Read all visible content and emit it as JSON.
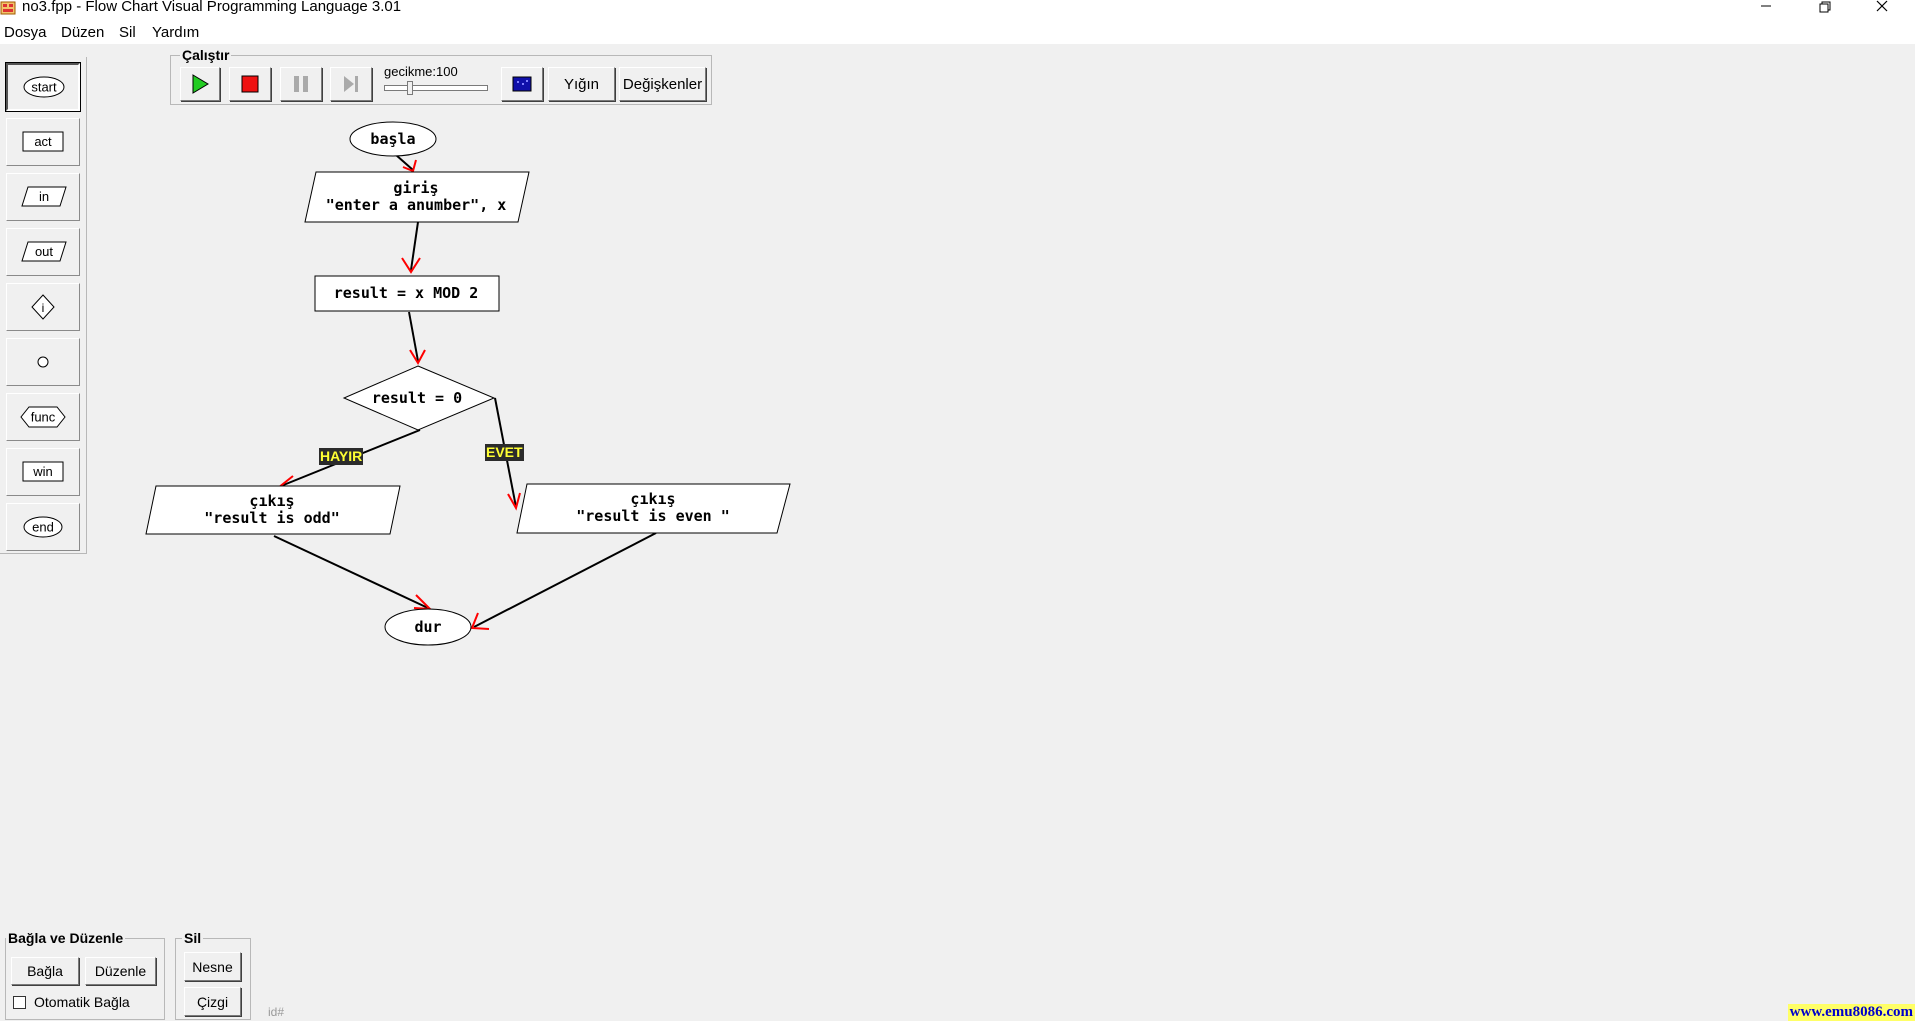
{
  "window": {
    "title": "no3.fpp - Flow Chart Visual Programming Language 3.01"
  },
  "menu": [
    "Dosya",
    "Düzen",
    "Sil",
    "Yardım"
  ],
  "palette": [
    {
      "name": "start",
      "label": "start",
      "active": true
    },
    {
      "name": "act",
      "label": "act"
    },
    {
      "name": "in",
      "label": "in"
    },
    {
      "name": "out",
      "label": "out"
    },
    {
      "name": "if",
      "label": "i"
    },
    {
      "name": "connector",
      "label": ""
    },
    {
      "name": "func",
      "label": "func"
    },
    {
      "name": "win",
      "label": "win"
    },
    {
      "name": "end",
      "label": "end"
    }
  ],
  "run_toolbar": {
    "title": "Çalıştır",
    "delay_label": "gecikme:100",
    "stack_label": "Yığın",
    "variables_label": "Değişkenler"
  },
  "flowchart": {
    "start": "başla",
    "input_line1": "giriş",
    "input_line2": "\"enter a anumber\", x",
    "action": "result = x MOD 2",
    "decision": "result = 0",
    "no_label": "HAYIR",
    "yes_label": "EVET",
    "output_odd_line1": "çıkış",
    "output_odd_line2": "\"result is odd\"",
    "output_even_line1": "çıkış",
    "output_even_line2": "\"result is even \"",
    "end": "dur"
  },
  "connect_group": {
    "title": "Bağla ve Düzenle",
    "connect_label": "Bağla",
    "arrange_label": "Düzenle",
    "auto_connect_label": "Otomatik Bağla",
    "auto_connect_checked": false
  },
  "delete_group": {
    "title": "Sil",
    "object_label": "Nesne",
    "line_label": "Çizgi"
  },
  "id_label": "id#",
  "website": "www.emu8086.com",
  "colors": {
    "play": "#22cc22",
    "stop": "#ee1111",
    "arrow": "#ff0000",
    "label_bg": "#2b2b2b",
    "label_fg": "#ffff33"
  }
}
